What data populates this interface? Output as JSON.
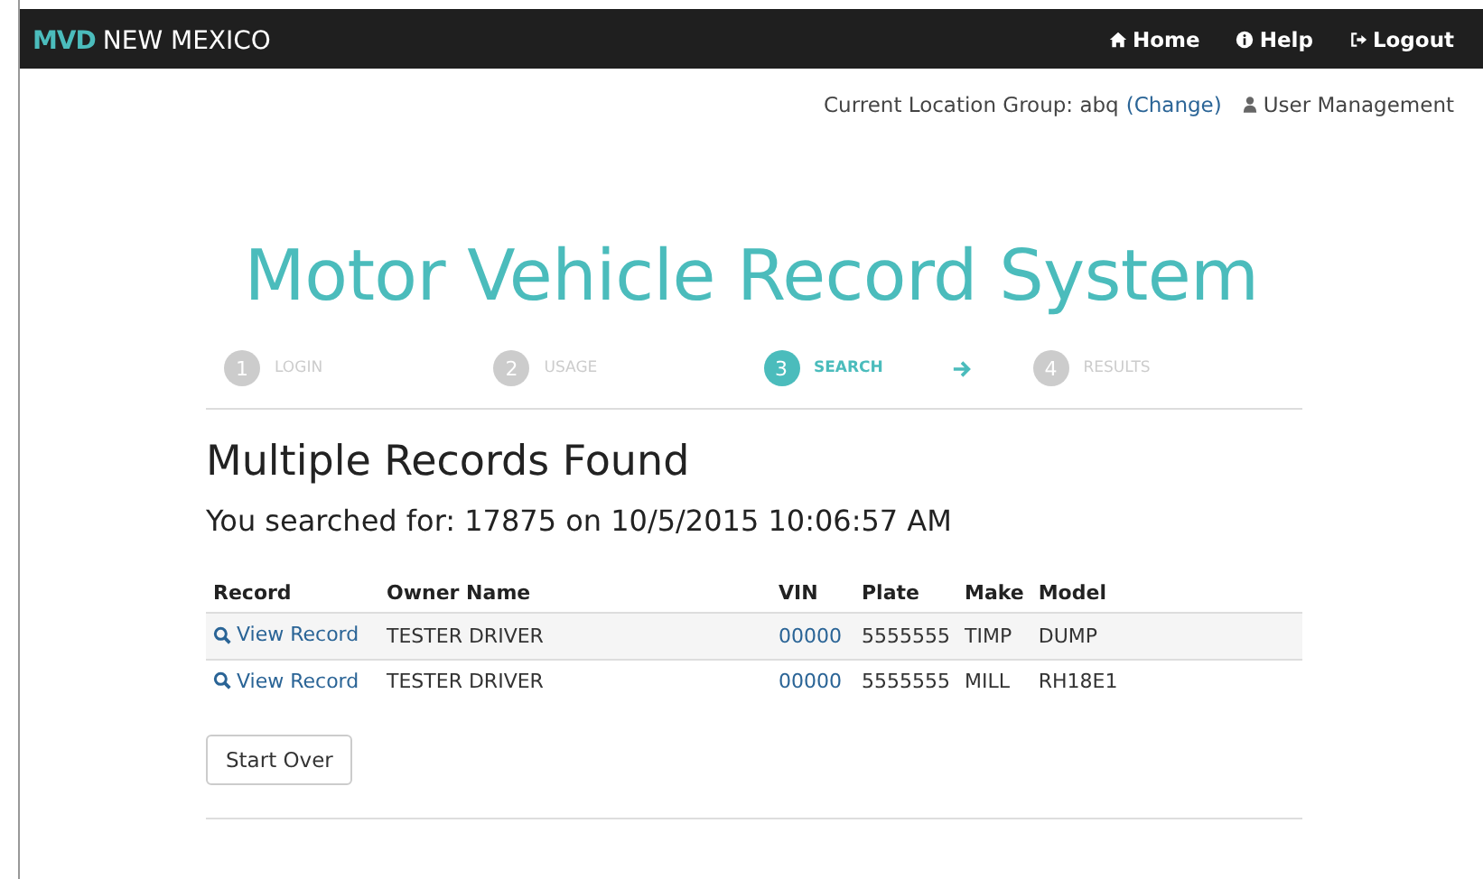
{
  "navbar": {
    "brand_mark": "MVD",
    "brand_name": "NEW MEXICO",
    "links": [
      "Home",
      "Help",
      "Logout"
    ]
  },
  "subbar": {
    "location_label": "Current Location Group: abq",
    "change_link": "(Change)",
    "user_management": "User Management"
  },
  "title": "Motor Vehicle Record System",
  "steps": [
    {
      "number": "1",
      "label": "LOGIN",
      "selected": false
    },
    {
      "number": "2",
      "label": "USAGE",
      "selected": false
    },
    {
      "number": "3",
      "label": "SEARCH",
      "selected": true
    },
    {
      "number": "4",
      "label": "RESULTS",
      "selected": false
    }
  ],
  "heading": "Multiple Records Found",
  "searched": "You searched for: 17875 on 10/5/2015 10:06:57 AM",
  "table": {
    "columns": [
      "Record",
      "Owner Name",
      "VIN",
      "Plate",
      "Make",
      "Model"
    ],
    "rows": [
      {
        "record": "View Record",
        "owner": "TESTER DRIVER",
        "vin": "00000",
        "plate": "5555555",
        "make": "TIMP",
        "model": "DUMP"
      },
      {
        "record": "View Record",
        "owner": "TESTER DRIVER",
        "vin": "00000",
        "plate": "5555555",
        "make": "MILL",
        "model": "RH18E1"
      }
    ]
  },
  "buttons": [
    "Start Over"
  ]
}
